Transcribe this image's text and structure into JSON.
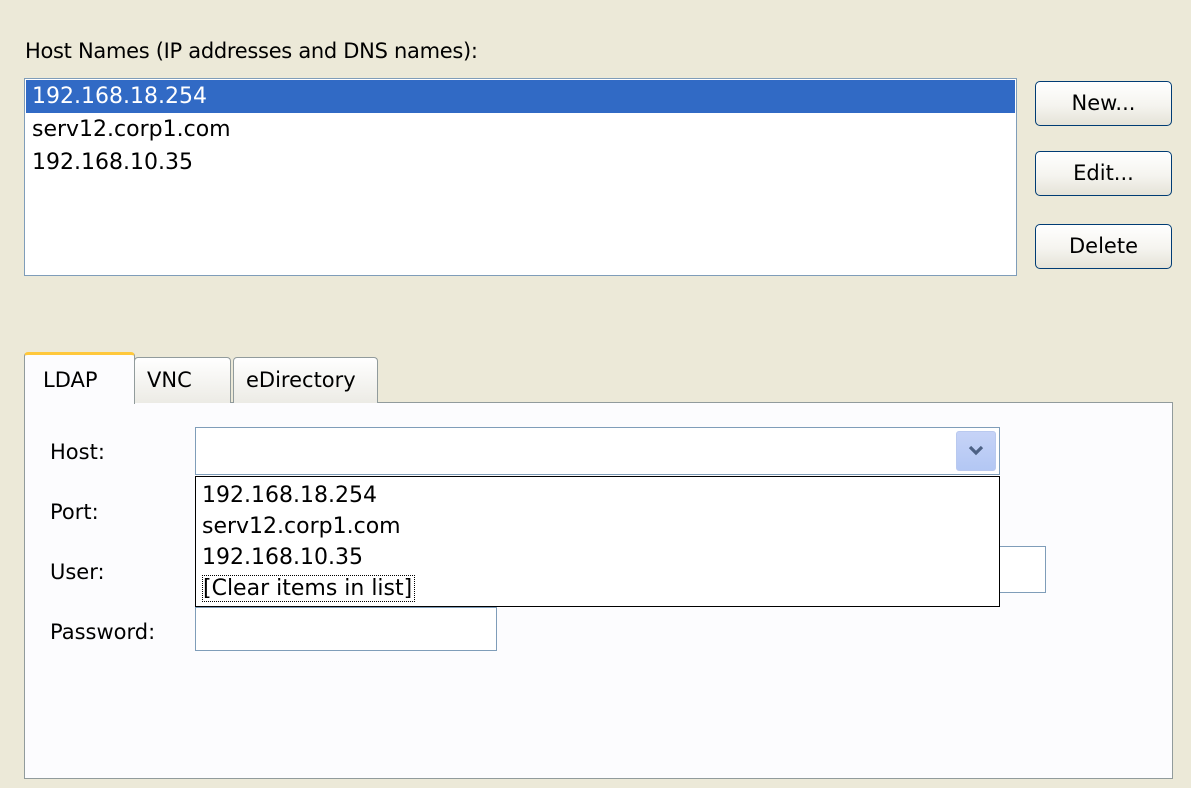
{
  "hosts_section": {
    "label": "Host Names (IP addresses and DNS names):",
    "items": [
      "192.168.18.254",
      "serv12.corp1.com",
      "192.168.10.35"
    ],
    "selected_index": 0
  },
  "buttons": {
    "new_label": "New...",
    "edit_label": "Edit...",
    "delete_label": "Delete"
  },
  "tabs": [
    {
      "label": "LDAP",
      "active": true
    },
    {
      "label": "VNC",
      "active": false
    },
    {
      "label": "eDirectory",
      "active": false
    }
  ],
  "form": {
    "host_label": "Host:",
    "port_label": "Port:",
    "user_label": "User:",
    "password_label": "Password:",
    "host_value": ""
  },
  "host_dropdown": {
    "options": [
      "192.168.18.254",
      "serv12.corp1.com",
      "192.168.10.35",
      "[Clear items in list]"
    ]
  },
  "colors": {
    "window_bg": "#ece9d8",
    "selection": "#316ac5",
    "field_border": "#7f9db9",
    "active_tab_accent": "#ffc83c"
  },
  "icons": {
    "combo_arrow": "chevron-down-icon"
  }
}
